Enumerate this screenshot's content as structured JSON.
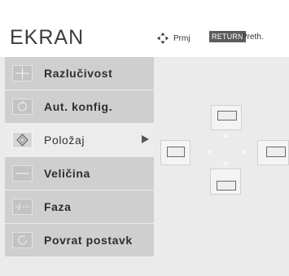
{
  "header": {
    "title": "EKRAN",
    "move_hint": "Prmj",
    "return_key": "RETURN",
    "return_label": "Preth."
  },
  "menu": {
    "items": [
      {
        "label": "Razlučivost",
        "icon": "resolution-icon"
      },
      {
        "label": "Aut. konfig.",
        "icon": "auto-config-icon"
      },
      {
        "label": "Položaj",
        "icon": "position-icon",
        "selected": true
      },
      {
        "label": "Veličina",
        "icon": "size-icon"
      },
      {
        "label": "Faza",
        "icon": "phase-icon"
      },
      {
        "label": "Povrat postavk",
        "icon": "reset-icon"
      }
    ]
  },
  "position_control": {
    "directions": [
      "up",
      "left",
      "right",
      "down"
    ]
  },
  "colors": {
    "background": "#ebebeb",
    "menu_item": "#cfcfcf",
    "selected_item": "#ececec",
    "return_key_bg": "#5c5c5c"
  }
}
